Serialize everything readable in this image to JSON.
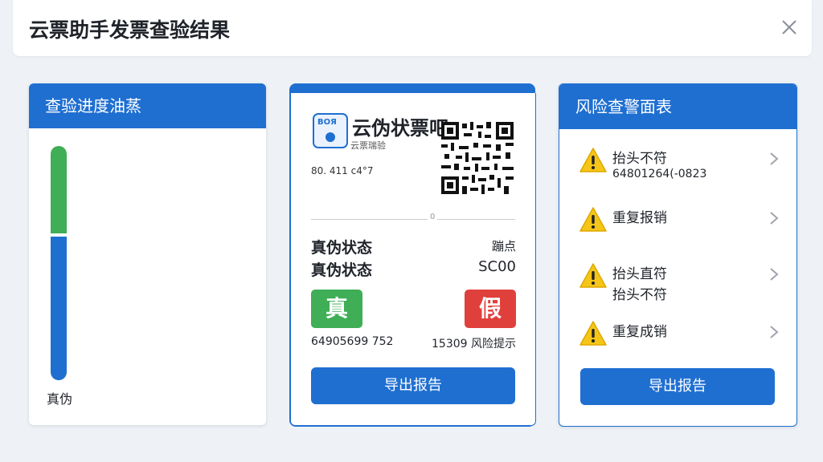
{
  "header": {
    "title": "云票助手发票查验结果"
  },
  "left_panel": {
    "title": "查验进度油蒸",
    "progress": {
      "green_fraction": 0.38,
      "blue_fraction": 0.62
    },
    "footer_label": "真伪"
  },
  "center_card": {
    "logo_text": "BOЯ",
    "brand_title": "云伪状票吧",
    "brand_subtitle": "云票瑞验",
    "code": "80. 411 c4°7",
    "divider_label": "0",
    "row1": {
      "label": "真伪状态",
      "value": "蹦点"
    },
    "row2": {
      "label": "真伪状态",
      "value": "SC00"
    },
    "badge_real": "真",
    "badge_fake": "假",
    "bottom_left": "64905699 752",
    "bottom_right": "15309 风险提示",
    "export_button": "导出报告"
  },
  "right_panel": {
    "title": "风险查警面表",
    "items": [
      {
        "line1": "抬头不符",
        "line2": "64801264(-0823"
      },
      {
        "line1": "重复报销",
        "line2": ""
      },
      {
        "line1": "抬头直符",
        "line2": "抬头不符"
      },
      {
        "line1": "重复成销",
        "line2": ""
      }
    ],
    "export_button": "导出报告"
  },
  "colors": {
    "primary": "#1f6fd1",
    "success": "#3fae56",
    "danger": "#e0403c",
    "warning": "#f5c518"
  }
}
